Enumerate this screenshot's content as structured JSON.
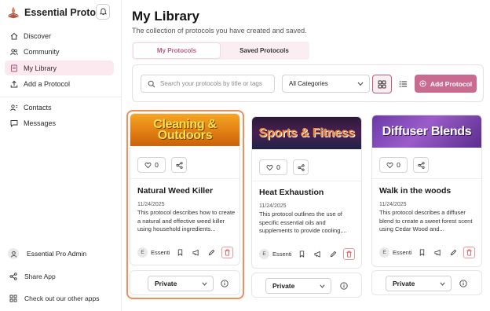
{
  "app": {
    "title": "Essential Protocol"
  },
  "sidebar": {
    "items": [
      {
        "label": "Discover",
        "icon": "home-icon"
      },
      {
        "label": "Community",
        "icon": "users-icon"
      },
      {
        "label": "My Library",
        "icon": "library-icon",
        "active": true
      },
      {
        "label": "Add a Protocol",
        "icon": "upload-icon"
      },
      {
        "label": "Contacts",
        "icon": "contacts-icon"
      },
      {
        "label": "Messages",
        "icon": "message-icon"
      }
    ],
    "user": {
      "name": "Essential Pro Admin"
    },
    "footer": [
      {
        "label": "Share App",
        "icon": "share-icon"
      },
      {
        "label": "Check out our other apps",
        "icon": "grid-icon"
      }
    ]
  },
  "page": {
    "title": "My Library",
    "subtitle": "The collection of protocols you have created and saved."
  },
  "tabs": [
    {
      "label": "My Protocols",
      "active": true
    },
    {
      "label": "Saved Protocols",
      "active": false
    }
  ],
  "toolbar": {
    "search_placeholder": "Search your protocols by title or tags",
    "category_value": "All Categories",
    "add_label": "Add Protocol"
  },
  "colors": {
    "accent": "#c96b90",
    "accent_light": "#fbeef2",
    "highlight_outline": "#ee8f5c"
  },
  "cards": [
    {
      "image_text": "Cleaning & Outdoors",
      "likes": "0",
      "title": "Natural Weed Killer",
      "date": "11/24/2025",
      "description": "This protocol describes how to create a natural and effective weed killer using household ingredients...",
      "author_initial": "E",
      "author": "Essential Pro Admin",
      "visibility": "Private"
    },
    {
      "image_text": "Sports & Fitness",
      "likes": "0",
      "title": "Heat Exhaustion",
      "date": "11/24/2025",
      "description": "This protocol outlines the use of specific essential oils and supplements to provide cooling,...",
      "author_initial": "E",
      "author": "Essential Pro Admin",
      "visibility": "Private"
    },
    {
      "image_text": "Diffuser Blends",
      "likes": "0",
      "title": "Walk in the woods",
      "date": "11/24/2025",
      "description": "This protocol describes a diffuser blend to create a sweet forest scent using Cedar Wood and...",
      "author_initial": "E",
      "author": "Essential Pro Admin",
      "visibility": "Private"
    }
  ]
}
